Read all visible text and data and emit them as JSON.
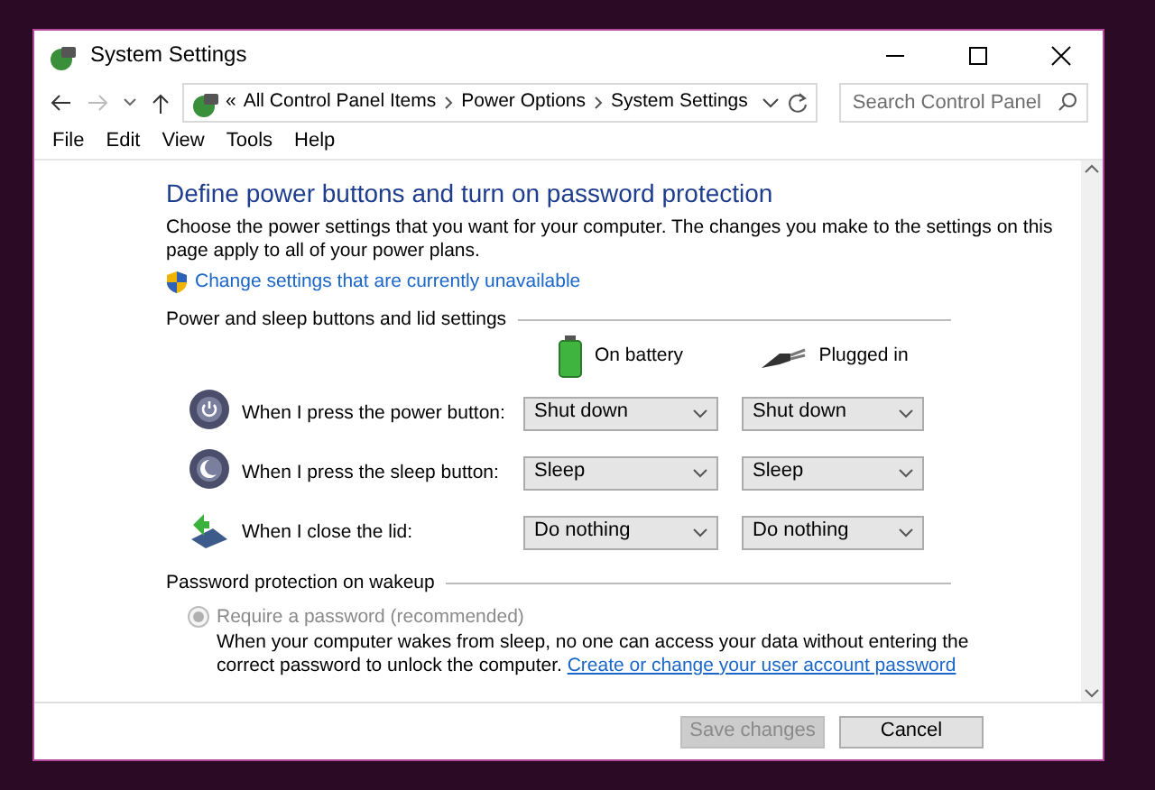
{
  "window": {
    "title": "System Settings"
  },
  "address": {
    "overflow": "«",
    "breadcrumb": [
      "All Control Panel Items",
      "Power Options",
      "System Settings"
    ]
  },
  "search": {
    "placeholder": "Search Control Panel"
  },
  "menu": [
    "File",
    "Edit",
    "View",
    "Tools",
    "Help"
  ],
  "heading": "Define power buttons and turn on password protection",
  "description": "Choose the power settings that you want for your computer. The changes you make to the settings on this page apply to all of your power plans.",
  "admin_link": "Change settings that are currently unavailable",
  "power_section": {
    "title": "Power and sleep buttons and lid settings",
    "columns": [
      {
        "kind": "battery",
        "label": "On battery"
      },
      {
        "kind": "plug",
        "label": "Plugged in"
      }
    ],
    "rows": [
      {
        "kind": "power",
        "label": "When I press the power button:",
        "values": [
          "Shut down",
          "Shut down"
        ]
      },
      {
        "kind": "sleep",
        "label": "When I press the sleep button:",
        "values": [
          "Sleep",
          "Sleep"
        ]
      },
      {
        "kind": "lid",
        "label": "When I close the lid:",
        "values": [
          "Do nothing",
          "Do nothing"
        ]
      }
    ]
  },
  "password_section": {
    "title": "Password protection on wakeup",
    "options": [
      {
        "label": "Require a password (recommended)",
        "selected": true,
        "disabled": true,
        "description": "When your computer wakes from sleep, no one can access your data without entering the correct password to unlock the computer.",
        "link": "Create or change your user account password"
      }
    ]
  },
  "buttons": [
    {
      "label": "Save changes",
      "disabled": true
    },
    {
      "label": "Cancel",
      "disabled": false
    }
  ]
}
